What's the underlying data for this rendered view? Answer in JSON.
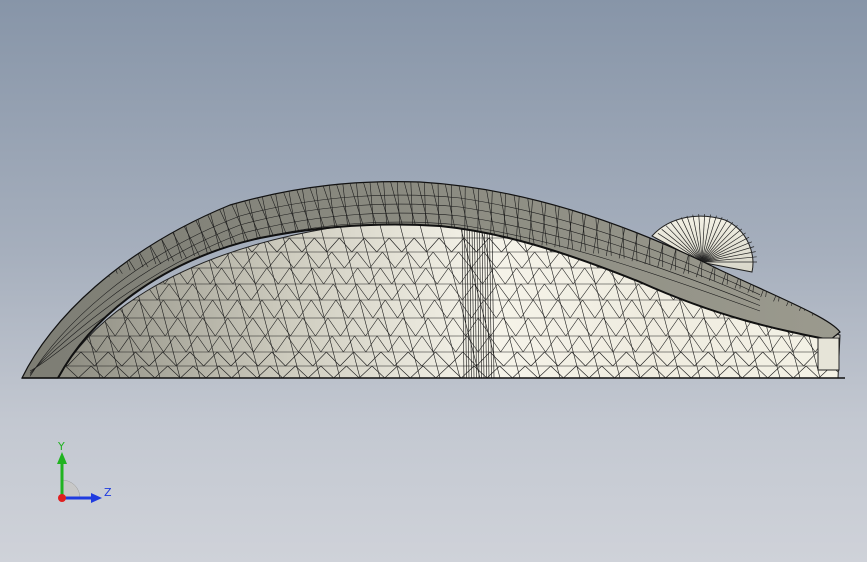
{
  "viewport": {
    "background_top": "#8795a8",
    "background_bottom": "#cfd2d9"
  },
  "model": {
    "name": "mouse-shell-mesh",
    "mesh_color": "#1c1c1c",
    "shell_light": "#f4f2e6",
    "shell_mid": "#c9c7b8",
    "shell_dark": "#7d7d74"
  },
  "triad": {
    "y_label": "Y",
    "z_label": "Z",
    "y_color": "#21b321",
    "z_color": "#1f3be0",
    "x_color": "#e01f1f"
  }
}
